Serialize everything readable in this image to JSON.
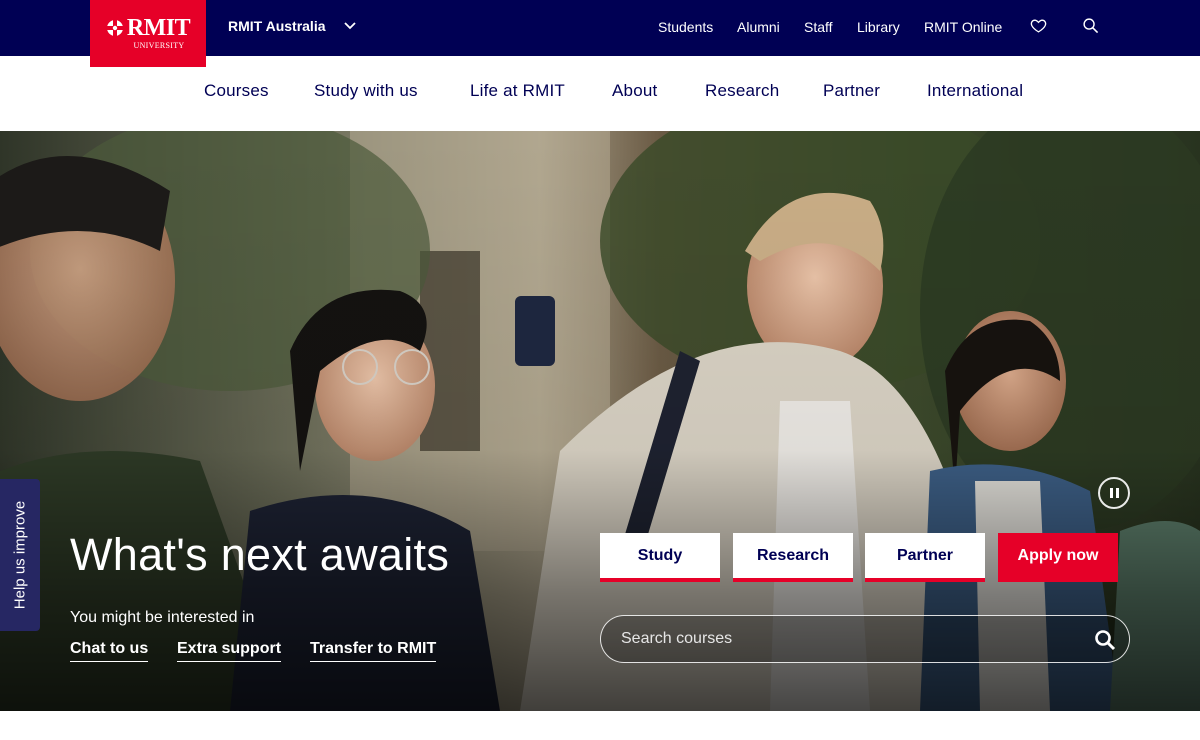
{
  "brand": {
    "logo_text": "RMIT",
    "logo_subtext": "UNIVERSITY",
    "region_label": "RMIT Australia"
  },
  "utility_nav": {
    "items": [
      "Students",
      "Alumni",
      "Staff",
      "Library",
      "RMIT Online"
    ],
    "icons": [
      "heart-icon",
      "search-icon"
    ]
  },
  "main_nav": {
    "items": [
      "Courses",
      "Study with us",
      "Life at RMIT",
      "About",
      "Research",
      "Partner",
      "International"
    ]
  },
  "hero": {
    "headline": "What's next awaits",
    "interest_label": "You might be interested in",
    "quick_links": [
      "Chat to us",
      "Extra support",
      "Transfer to RMIT"
    ],
    "buttons": [
      "Study",
      "Research",
      "Partner",
      "Apply now"
    ],
    "search_placeholder": "Search courses"
  },
  "feedback_tab": "Help us improve",
  "colors": {
    "navy": "#000054",
    "red": "#e60028",
    "white": "#ffffff",
    "feedback_bg": "#262763"
  }
}
